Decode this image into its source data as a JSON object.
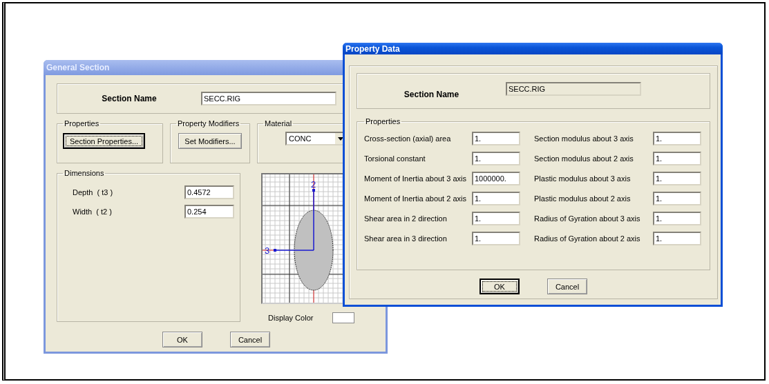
{
  "general_section": {
    "title": "General Section",
    "active": false,
    "section_name": {
      "label": "Section Name",
      "value": "SECC.RIG"
    },
    "properties": {
      "label": "Properties",
      "button": "Section Properties...",
      "default": true
    },
    "property_modifiers": {
      "label": "Property Modifiers",
      "button": "Set Modifiers..."
    },
    "material": {
      "label": "Material",
      "value": "CONC"
    },
    "dimensions": {
      "label": "Dimensions",
      "fields": [
        {
          "label": "Depth  ( t3 )",
          "value": "0.4572"
        },
        {
          "label": "Width  ( t2 )",
          "value": "0.254"
        }
      ]
    },
    "diagram": {
      "axis_labels": [
        "2",
        "3"
      ]
    },
    "display_color": {
      "label": "Display Color"
    },
    "buttons": [
      {
        "label": "OK",
        "default": false
      },
      {
        "label": "Cancel",
        "default": false
      }
    ]
  },
  "property_data": {
    "title": "Property Data",
    "active": true,
    "section_name": {
      "label": "Section Name",
      "value": "SECC.RIG"
    },
    "properties": {
      "label": "Properties",
      "rows": [
        {
          "left_label": "Cross-section (axial) area",
          "left_value": "1.",
          "right_label": "Section modulus about 3 axis",
          "right_value": "1."
        },
        {
          "left_label": "Torsional constant",
          "left_value": "1.",
          "right_label": "Section modulus about 2 axis",
          "right_value": "1."
        },
        {
          "left_label": "Moment of Inertia about 3 axis",
          "left_value": "1000000.",
          "right_label": "Plastic modulus about 3 axis",
          "right_value": "1."
        },
        {
          "left_label": "Moment of Inertia about 2 axis",
          "left_value": "1.",
          "right_label": "Plastic modulus about 2 axis",
          "right_value": "1."
        },
        {
          "left_label": "Shear area in 2 direction",
          "left_value": "1.",
          "right_label": "Radius of Gyration about 3 axis",
          "right_value": "1."
        },
        {
          "left_label": "Shear area in 3 direction",
          "left_value": "1.",
          "right_label": "Radius of Gyration about 2 axis",
          "right_value": "1."
        }
      ]
    },
    "buttons": [
      {
        "label": "OK",
        "default": true
      },
      {
        "label": "Cancel",
        "default": false
      }
    ]
  }
}
